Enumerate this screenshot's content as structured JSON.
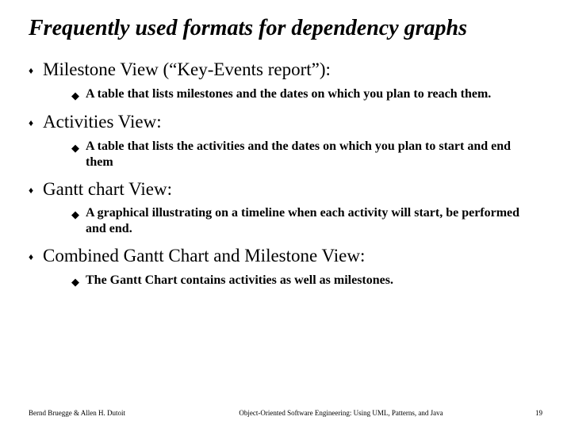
{
  "title": "Frequently used formats for dependency graphs",
  "items": [
    {
      "label": "Milestone View (“Key-Events report”):",
      "sub": "A table that lists milestones and the dates on which you plan to reach them."
    },
    {
      "label": "Activities View:",
      "sub": "A table that lists the activities and the dates on which you plan to start and end them"
    },
    {
      "label": "Gantt chart View:",
      "sub": "A graphical illustrating on a timeline when each activity will start, be performed and end."
    },
    {
      "label": "Combined Gantt Chart and Milestone View:",
      "sub": "The Gantt Chart contains activities as well as milestones."
    }
  ],
  "footer": {
    "left": "Bernd Bruegge & Allen H. Dutoit",
    "center": "Object-Oriented Software Engineering: Using UML, Patterns, and Java",
    "right": "19"
  },
  "bullets": {
    "level1": "♦",
    "level2": "◆"
  }
}
